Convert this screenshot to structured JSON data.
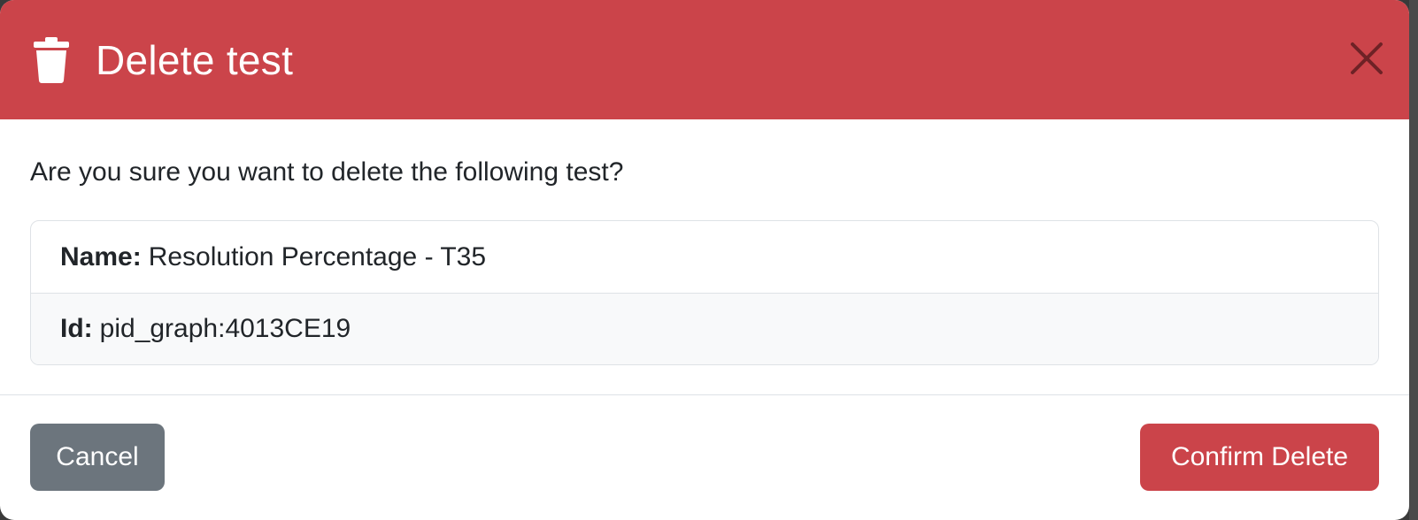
{
  "modal": {
    "title": "Delete test",
    "header_icon": "trash-icon",
    "close_icon": "close-icon",
    "header_color": "#cb444a"
  },
  "body": {
    "prompt": "Are you sure you want to delete the following test?",
    "details": [
      {
        "label": "Name:",
        "value": "Resolution Percentage - T35"
      },
      {
        "label": "Id:",
        "value": "pid_graph:4013CE19"
      }
    ]
  },
  "footer": {
    "cancel_label": "Cancel",
    "confirm_label": "Confirm Delete",
    "cancel_color": "#6c757d",
    "confirm_color": "#cb444a"
  }
}
